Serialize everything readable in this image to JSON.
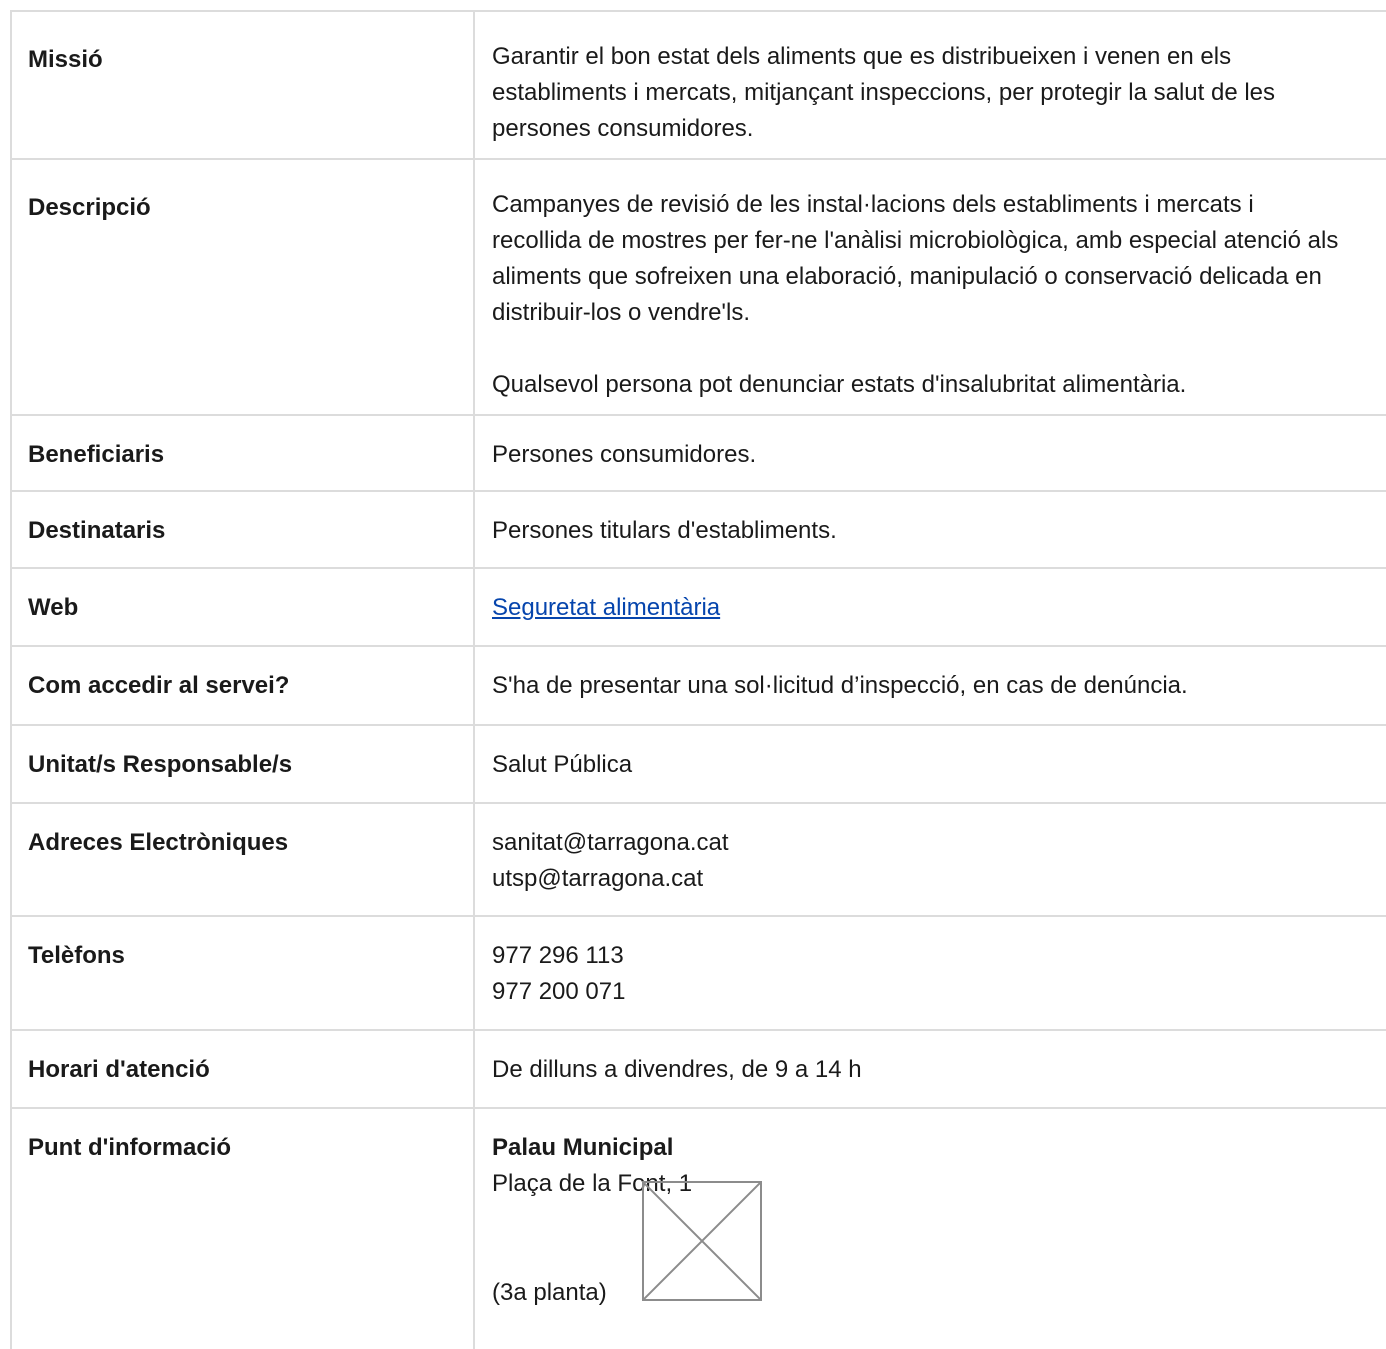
{
  "rows": [
    {
      "label": "Missió",
      "value": "Garantir el bon estat dels aliments que es distribueixen i venen en els establiments i mercats, mitjançant inspeccions, per protegir la salut de les persones consumidores."
    },
    {
      "label": "Descripció",
      "paragraph1": "Campanyes de revisió de les instal·lacions dels establiments i mercats i recollida de mostres per fer-ne l'anàlisi microbiològica, amb especial atenció als aliments que sofreixen una elaboració, manipulació o conservació delicada en distribuir-los o vendre'ls.",
      "paragraph2": "Qualsevol persona pot denunciar estats d'insalubritat alimentària."
    },
    {
      "label": "Beneficiaris",
      "value": "Persones consumidores."
    },
    {
      "label": "Destinataris",
      "value": "Persones titulars d'establiments."
    },
    {
      "label": "Web",
      "link": "Seguretat alimentària"
    },
    {
      "label": "Com accedir al servei?",
      "value": "S'ha de presentar una sol·licitud d’inspecció, en cas de denúncia."
    },
    {
      "label": "Unitat/s Responsable/s",
      "value": "Salut Pública"
    },
    {
      "label": "Adreces Electròniques",
      "lines": [
        "sanitat@tarragona.cat",
        "utsp@tarragona.cat"
      ]
    },
    {
      "label": "Telèfons",
      "lines": [
        "977 296 113",
        "977 200 071"
      ]
    },
    {
      "label": "Horari d'atenció",
      "value": "De dilluns a divendres, de 9 a 14 h"
    },
    {
      "label": "Punt d'informació",
      "title": "Palau Municipal",
      "address": "Plaça de la Font, 1",
      "floor": "(3a planta)"
    }
  ],
  "icons": {
    "broken_image": "broken-image-icon"
  }
}
